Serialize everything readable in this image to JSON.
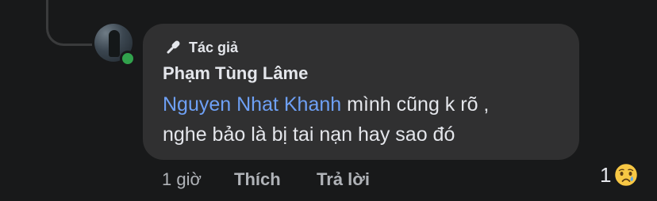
{
  "comment": {
    "author_badge": "Tác giả",
    "author_name": "Phạm Tùng Lâme",
    "mention": "Nguyen Nhat Khanh",
    "text_line1": " mình cũng k rõ ,",
    "text_line2": "nghe bảo là bị tai nạn hay sao đó"
  },
  "actions": {
    "time": "1 giờ",
    "like_label": "Thích",
    "reply_label": "Trả lời"
  },
  "reaction": {
    "count": "1",
    "icon": "sad-emoji-icon"
  },
  "colors": {
    "background": "#18191a",
    "bubble": "#303031",
    "mention": "#6ea0f5",
    "online": "#31a24c"
  }
}
